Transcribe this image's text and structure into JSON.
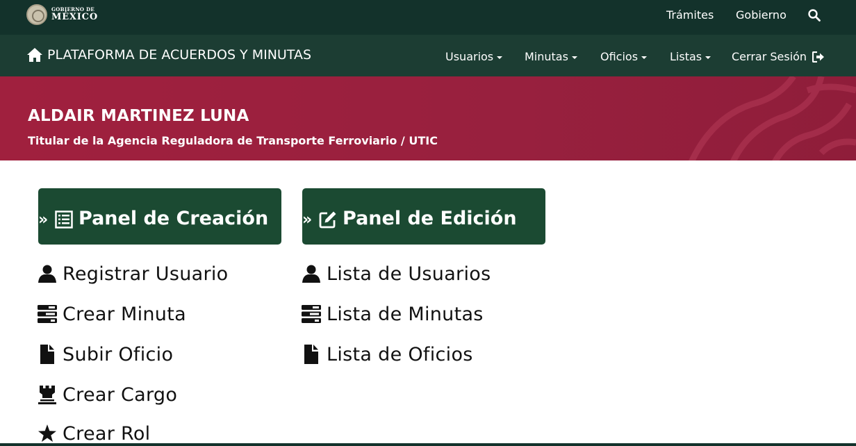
{
  "gov_bar": {
    "logo_line1": "GOBIERNO DE",
    "logo_line2": "MÉXICO",
    "links": [
      "Trámites",
      "Gobierno"
    ],
    "search_icon": "search-icon"
  },
  "nav": {
    "brand": "PLATAFORMA DE ACUERDOS Y MINUTAS",
    "brand_icon": "home-icon",
    "items": [
      "Usuarios",
      "Minutas",
      "Oficios",
      "Listas"
    ],
    "logout": "Cerrar Sesión",
    "logout_icon": "logout-icon"
  },
  "banner": {
    "name": "ALDAIR MARTINEZ LUNA",
    "role": "Titular de la Agencia Reguladora de Transporte Ferroviario / UTIC"
  },
  "panels": {
    "creation": {
      "prefix": "»",
      "title": "Panel de Creación",
      "icon": "list-icon",
      "links": [
        {
          "label": "Registrar Usuario",
          "icon": "user-icon"
        },
        {
          "label": "Crear Minuta",
          "icon": "tasks-icon"
        },
        {
          "label": "Subir Oficio",
          "icon": "file-icon"
        },
        {
          "label": "Crear Cargo",
          "icon": "chess-rook-icon"
        },
        {
          "label": "Crear Rol",
          "icon": "star-icon"
        }
      ]
    },
    "edition": {
      "prefix": "»",
      "title": "Panel de Edición",
      "icon": "edit-icon",
      "links": [
        {
          "label": "Lista de Usuarios",
          "icon": "user-icon"
        },
        {
          "label": "Lista de Minutas",
          "icon": "tasks-icon"
        },
        {
          "label": "Lista de Oficios",
          "icon": "file-icon"
        }
      ]
    }
  },
  "colors": {
    "gov_bar": "#13322b",
    "nav_bar": "#1c3d33",
    "banner": "#9d2042",
    "panel": "#1b4a32"
  }
}
